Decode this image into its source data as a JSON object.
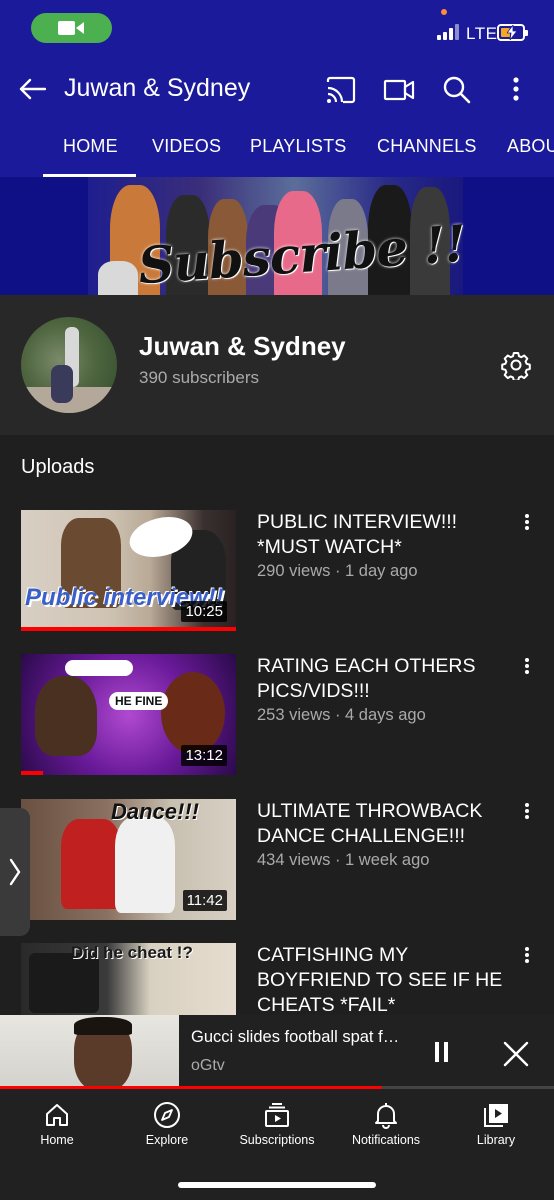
{
  "status_bar": {
    "network": "LTE"
  },
  "app_bar": {
    "title": "Juwan & Sydney",
    "icons": [
      "back-arrow-icon",
      "cast-icon",
      "video-camera-icon",
      "search-icon",
      "more-vert-icon"
    ]
  },
  "tabs": [
    {
      "label": "HOME",
      "selected": true
    },
    {
      "label": "VIDEOS",
      "selected": false
    },
    {
      "label": "PLAYLISTS",
      "selected": false
    },
    {
      "label": "CHANNELS",
      "selected": false
    },
    {
      "label": "ABOUT",
      "selected": false
    }
  ],
  "banner": {
    "text": "Subscribe !!"
  },
  "channel": {
    "name": "Juwan & Sydney",
    "subscribers": "390 subscribers"
  },
  "uploads": {
    "heading": "Uploads",
    "videos": [
      {
        "title": "PUBLIC INTERVIEW!!! *MUST WATCH*",
        "meta": "290 views · 1 day ago",
        "duration": "10:25",
        "thumb_text": "Public interview!!",
        "watched_fraction": 1.0
      },
      {
        "title": "RATING EACH OTHERS PICS/VIDS!!!",
        "meta": "253 views · 4 days ago",
        "duration": "13:12",
        "thumb_text": "HE FINE",
        "watched_fraction": 0.1
      },
      {
        "title": "ULTIMATE THROWBACK DANCE CHALLENGE!!!",
        "meta": "434 views · 1 week ago",
        "duration": "11:42",
        "thumb_text": "Dance!!!",
        "watched_fraction": 0.0
      },
      {
        "title": "CATFISHING MY BOYFRIEND TO SEE IF HE CHEATS *FAIL*",
        "meta": "",
        "duration": "",
        "thumb_text": "Did he cheat !?",
        "watched_fraction": 0.0
      }
    ]
  },
  "mini_player": {
    "title": "Gucci slides football spat ft....",
    "channel": "oGtv",
    "progress_fraction": 0.69
  },
  "bottom_nav": [
    {
      "label": "Home",
      "icon": "home-icon"
    },
    {
      "label": "Explore",
      "icon": "compass-icon"
    },
    {
      "label": "Subscriptions",
      "icon": "subscriptions-icon"
    },
    {
      "label": "Notifications",
      "icon": "bell-icon"
    },
    {
      "label": "Library",
      "icon": "library-icon"
    }
  ],
  "colors": {
    "brand_bar": "#1a1a9a",
    "accent_red": "#ff0000",
    "background": "#282828"
  }
}
